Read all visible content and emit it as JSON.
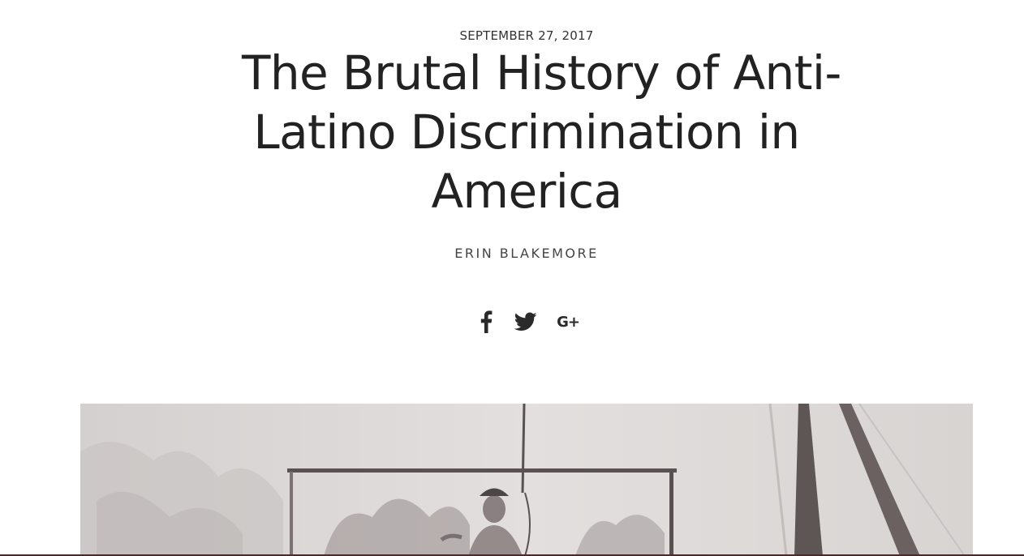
{
  "article": {
    "date": "SEPTEMBER 27, 2017",
    "title_lines": [
      "The Brutal History of Anti-",
      "Latino Discrimination in",
      "America"
    ],
    "author": "ERIN BLAKEMORE"
  },
  "share": {
    "icons": [
      "facebook-icon",
      "twitter-icon",
      "google-plus-icon"
    ],
    "google_plus_label": "G+"
  },
  "hero_image": {
    "description_hidden": true,
    "colors": {
      "paper": "#dcd9d8",
      "ink": "#5a5252"
    }
  }
}
